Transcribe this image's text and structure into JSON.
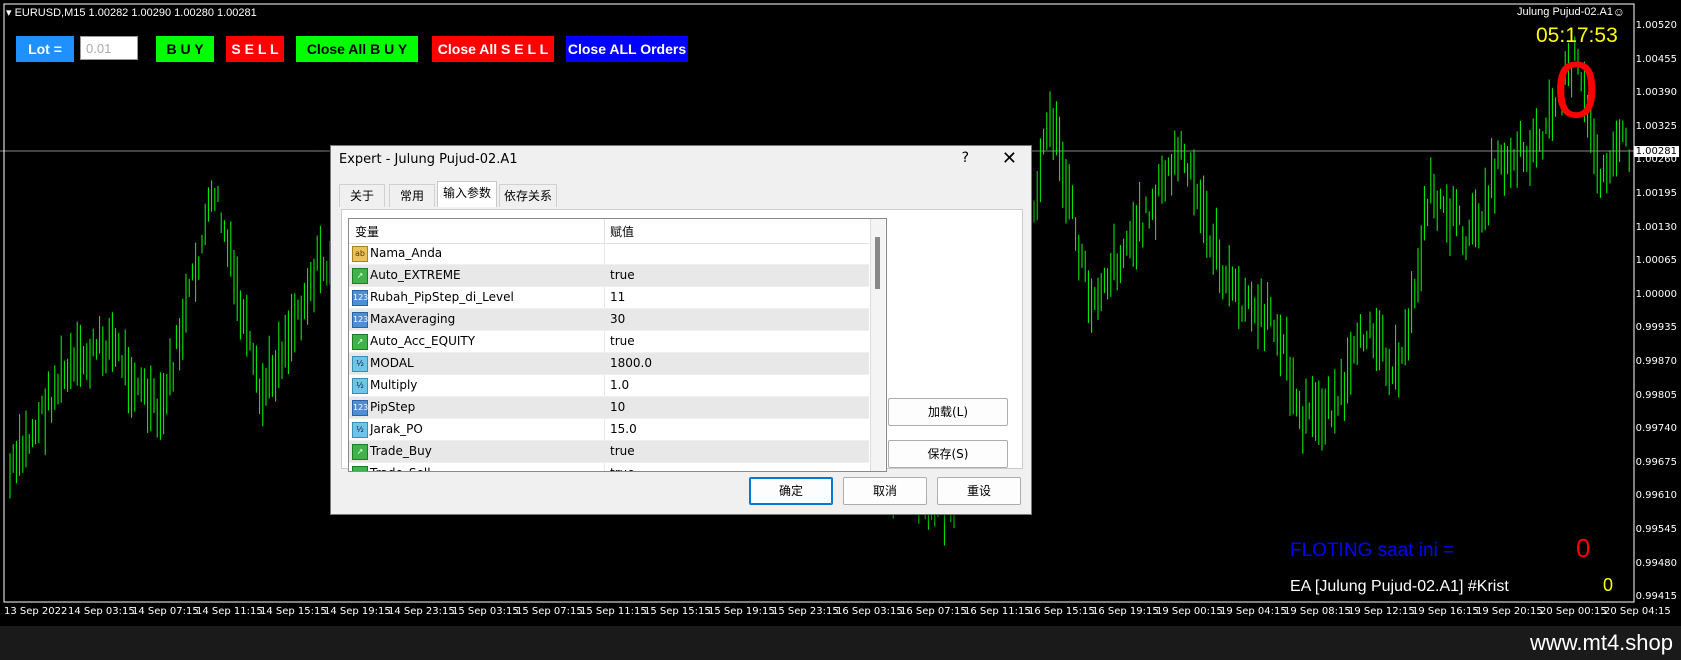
{
  "chart": {
    "symbol_header": "EURUSD,M15  1.00282 1.00290 1.00280 1.00281",
    "ea_label_top": "Julung Pujud-02.A1",
    "timer": "05:17:53",
    "big_zero": "0",
    "current_price": "1.00281",
    "price_scale": [
      "1.00520",
      "1.00455",
      "1.00390",
      "1.00325",
      "1.00260",
      "1.00195",
      "1.00130",
      "1.00065",
      "1.00000",
      "0.99935",
      "0.99870",
      "0.99805",
      "0.99740",
      "0.99675",
      "0.99610",
      "0.99545",
      "0.99480",
      "0.99415"
    ],
    "time_ticks": [
      "13 Sep 2022",
      "14 Sep 03:15",
      "14 Sep 07:15",
      "14 Sep 11:15",
      "14 Sep 15:15",
      "14 Sep 19:15",
      "14 Sep 23:15",
      "15 Sep 03:15",
      "15 Sep 07:15",
      "15 Sep 11:15",
      "15 Sep 15:15",
      "15 Sep 19:15",
      "15 Sep 23:15",
      "16 Sep 03:15",
      "16 Sep 07:15",
      "16 Sep 11:15",
      "16 Sep 15:15",
      "16 Sep 19:15",
      "19 Sep 00:15",
      "19 Sep 04:15",
      "19 Sep 08:15",
      "19 Sep 12:15",
      "19 Sep 16:15",
      "19 Sep 20:15",
      "20 Sep 00:15",
      "20 Sep 04:15"
    ],
    "candle_color": "#00ff00",
    "floating_label": "FLOTING saat ini =",
    "floating_value": "0",
    "ea_footer": "EA [Julung Pujud-02.A1] #Krist",
    "ea_footer_value": "0",
    "watermark": "www.mt4.shop"
  },
  "toolbar": {
    "lot_label": "Lot  =",
    "lot_value": "0.01",
    "buy_label": "B U Y",
    "sell_label": "S E L L",
    "close_buy_label": "Close All  B U Y",
    "close_sell_label": "Close All  S E L L",
    "close_orders_label": "Close ALL Orders",
    "colors": {
      "lot": "#1e90ff",
      "buy": "#00ff00",
      "sell": "#ff0000",
      "close_orders": "#0000ff"
    }
  },
  "dialog": {
    "title": "Expert - Julung Pujud-02.A1",
    "help": "?",
    "close": "✕",
    "tabs": [
      "关于",
      "常用",
      "输入参数",
      "依存关系"
    ],
    "active_tab": "输入参数",
    "columns": [
      "变量",
      "赋值"
    ],
    "params": [
      {
        "icon": "ab",
        "name": "Nama_Anda",
        "value": ""
      },
      {
        "icon": "bool",
        "name": "Auto_EXTREME",
        "value": "true"
      },
      {
        "icon": "int",
        "name": "Rubah_PipStep_di_Level",
        "value": "11"
      },
      {
        "icon": "int",
        "name": "MaxAveraging",
        "value": "30"
      },
      {
        "icon": "bool",
        "name": "Auto_Acc_EQUITY",
        "value": "true"
      },
      {
        "icon": "dbl",
        "name": "MODAL",
        "value": "1800.0"
      },
      {
        "icon": "dbl",
        "name": "Multiply",
        "value": "1.0"
      },
      {
        "icon": "int",
        "name": "PipStep",
        "value": "10"
      },
      {
        "icon": "dbl",
        "name": "Jarak_PO",
        "value": "15.0"
      },
      {
        "icon": "bool",
        "name": "Trade_Buy",
        "value": "true"
      },
      {
        "icon": "bool",
        "name": "Trade_Sell",
        "value": "true"
      }
    ],
    "load_button": "加载(L)",
    "save_button": "保存(S)",
    "ok_button": "确定",
    "cancel_button": "取消",
    "reset_button": "重设"
  }
}
